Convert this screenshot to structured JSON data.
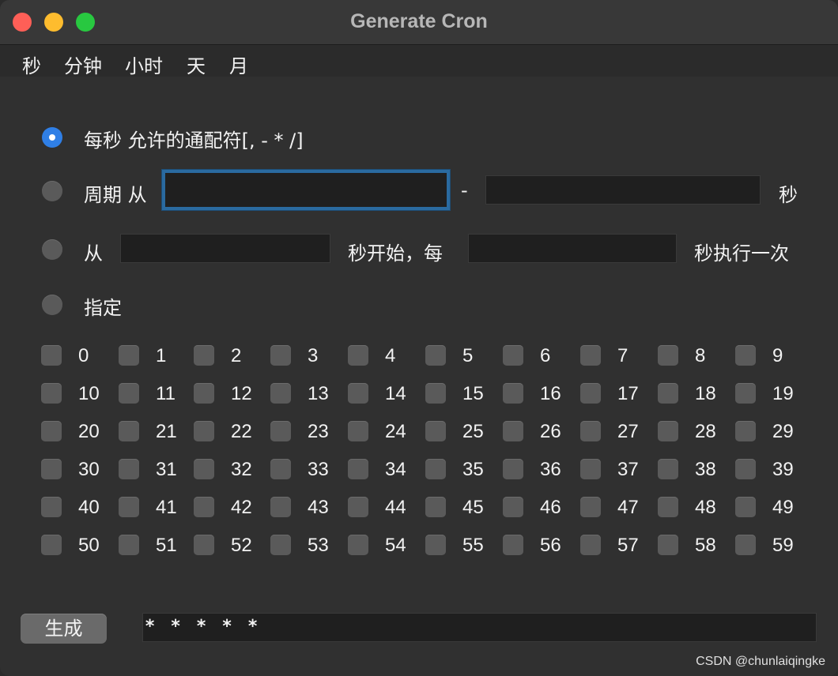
{
  "window": {
    "title": "Generate Cron"
  },
  "tabs": [
    "秒",
    "分钟",
    "小时",
    "天",
    "月"
  ],
  "options": {
    "every": "每秒 允许的通配符[, - * /]",
    "period_from": "周期 从",
    "period_dash": "-",
    "period_unit": "秒",
    "start_from": "从",
    "start_mid": "秒开始，每",
    "start_end": "秒执行一次",
    "specify": "指定"
  },
  "fields": {
    "period_start": "",
    "period_end": "",
    "start_at": "",
    "interval": ""
  },
  "seconds": [
    "0",
    "1",
    "2",
    "3",
    "4",
    "5",
    "6",
    "7",
    "8",
    "9",
    "10",
    "11",
    "12",
    "13",
    "14",
    "15",
    "16",
    "17",
    "18",
    "19",
    "20",
    "21",
    "22",
    "23",
    "24",
    "25",
    "26",
    "27",
    "28",
    "29",
    "30",
    "31",
    "32",
    "33",
    "34",
    "35",
    "36",
    "37",
    "38",
    "39",
    "40",
    "41",
    "42",
    "43",
    "44",
    "45",
    "46",
    "47",
    "48",
    "49",
    "50",
    "51",
    "52",
    "53",
    "54",
    "55",
    "56",
    "57",
    "58",
    "59"
  ],
  "footer": {
    "generate_label": "生成",
    "cron_output": "* * * * *"
  },
  "watermark": "CSDN @chunlaiqingke",
  "colors": {
    "accent": "#2f7fe6",
    "focus_ring": "#2a6aa0",
    "traffic_close": "#fe5f57",
    "traffic_min": "#febc2e",
    "traffic_max": "#28c840"
  }
}
